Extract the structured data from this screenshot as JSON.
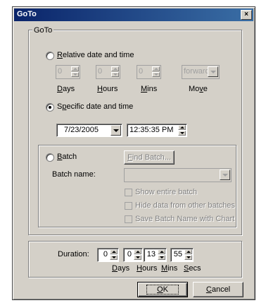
{
  "window": {
    "title": "GoTo",
    "close_glyph": "×"
  },
  "goto_group": {
    "legend": "GoTo"
  },
  "relative": {
    "label_mn": "R",
    "label_rest": "elative date and time",
    "days": "0",
    "hours": "0",
    "mins": "0",
    "direction": "forward",
    "days_label_mn": "D",
    "days_label_rest": "ays",
    "hours_label_mn": "H",
    "hours_label_rest": "ours",
    "mins_label_mn": "M",
    "mins_label_rest": "ins",
    "move_label_pre": "Mo",
    "move_label_mn": "v",
    "move_label_post": "e"
  },
  "specific": {
    "label_pre": "S",
    "label_mn": "p",
    "label_rest": "ecific date and time",
    "date": "7/23/2005",
    "time": "12:35:35 PM"
  },
  "batch": {
    "label_mn": "B",
    "label_rest": "atch",
    "find_button_mn": "F",
    "find_button_rest": "ind Batch...",
    "name_label": "Batch name:",
    "name_value": "",
    "show_entire": "Show entire batch",
    "hide_other": "Hide data from other batches",
    "save_name": "Save Batch Name with Chart"
  },
  "duration": {
    "label": "Duration:",
    "days": "0",
    "hours": "0",
    "mins": "13",
    "secs": "55",
    "days_label_mn": "D",
    "days_label_rest": "ays",
    "hours_label_mn": "H",
    "hours_label_rest": "ours",
    "mins_label_mn": "M",
    "mins_label_rest": "ins",
    "secs_label_mn": "S",
    "secs_label_rest": "ecs"
  },
  "buttons": {
    "ok_mn": "O",
    "ok_rest": "K",
    "cancel_mn": "C",
    "cancel_rest": "ancel"
  },
  "colors": {
    "face": "#d4d0c8",
    "title_start": "#0a246a",
    "title_end": "#3a6ea5",
    "disabled": "#808080"
  }
}
